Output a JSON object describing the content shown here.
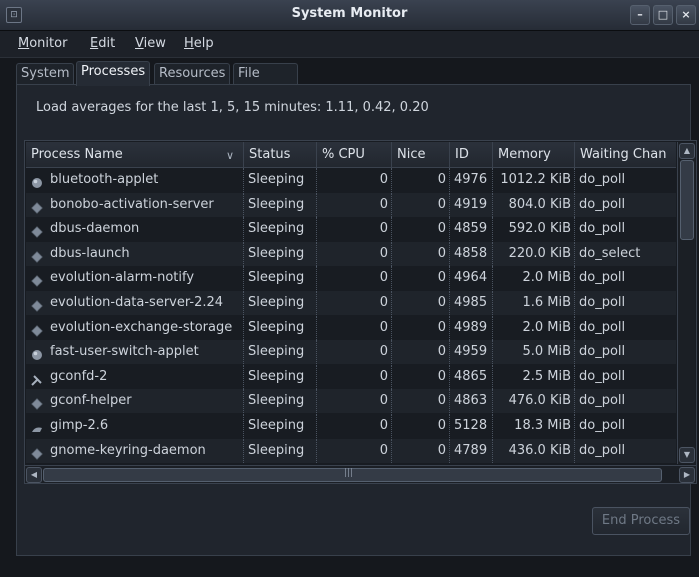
{
  "window": {
    "title": "System Monitor",
    "icon": "system-monitor-icon"
  },
  "titlebar_buttons": {
    "minimize": "–",
    "maximize": "□",
    "close": "×"
  },
  "menu": [
    "Monitor",
    "Edit",
    "View",
    "Help"
  ],
  "tabs": [
    "System",
    "Processes",
    "Resources",
    "File Systems"
  ],
  "active_tab": "Processes",
  "load_avg": "Load averages for the last 1, 5, 15 minutes: 1.11, 0.42, 0.20",
  "columns": [
    "Process Name",
    "Status",
    "% CPU",
    "Nice",
    "ID",
    "Memory",
    "Waiting Chan"
  ],
  "processes": [
    {
      "name": "bluetooth-applet",
      "status": "Sleeping",
      "cpu": "0",
      "nice": "0",
      "id": "4976",
      "memory": "1012.2 KiB",
      "wchan": "do_poll",
      "icon": "bluetooth-icon"
    },
    {
      "name": "bonobo-activation-server",
      "status": "Sleeping",
      "cpu": "0",
      "nice": "0",
      "id": "4919",
      "memory": "804.0 KiB",
      "wchan": "do_poll",
      "icon": "process-diamond-icon"
    },
    {
      "name": "dbus-daemon",
      "status": "Sleeping",
      "cpu": "0",
      "nice": "0",
      "id": "4859",
      "memory": "592.0 KiB",
      "wchan": "do_poll",
      "icon": "process-diamond-icon"
    },
    {
      "name": "dbus-launch",
      "status": "Sleeping",
      "cpu": "0",
      "nice": "0",
      "id": "4858",
      "memory": "220.0 KiB",
      "wchan": "do_select",
      "icon": "process-diamond-icon"
    },
    {
      "name": "evolution-alarm-notify",
      "status": "Sleeping",
      "cpu": "0",
      "nice": "0",
      "id": "4964",
      "memory": "2.0 MiB",
      "wchan": "do_poll",
      "icon": "process-diamond-icon"
    },
    {
      "name": "evolution-data-server-2.24",
      "status": "Sleeping",
      "cpu": "0",
      "nice": "0",
      "id": "4985",
      "memory": "1.6 MiB",
      "wchan": "do_poll",
      "icon": "process-diamond-icon"
    },
    {
      "name": "evolution-exchange-storage",
      "status": "Sleeping",
      "cpu": "0",
      "nice": "0",
      "id": "4989",
      "memory": "2.0 MiB",
      "wchan": "do_poll",
      "icon": "process-diamond-icon"
    },
    {
      "name": "fast-user-switch-applet",
      "status": "Sleeping",
      "cpu": "0",
      "nice": "0",
      "id": "4959",
      "memory": "5.0 MiB",
      "wchan": "do_poll",
      "icon": "user-icon"
    },
    {
      "name": "gconfd-2",
      "status": "Sleeping",
      "cpu": "0",
      "nice": "0",
      "id": "4865",
      "memory": "2.5 MiB",
      "wchan": "do_poll",
      "icon": "tools-icon"
    },
    {
      "name": "gconf-helper",
      "status": "Sleeping",
      "cpu": "0",
      "nice": "0",
      "id": "4863",
      "memory": "476.0 KiB",
      "wchan": "do_poll",
      "icon": "process-diamond-icon"
    },
    {
      "name": "gimp-2.6",
      "status": "Sleeping",
      "cpu": "0",
      "nice": "0",
      "id": "5128",
      "memory": "18.3 MiB",
      "wchan": "do_poll",
      "icon": "gimp-icon"
    },
    {
      "name": "gnome-keyring-daemon",
      "status": "Sleeping",
      "cpu": "0",
      "nice": "0",
      "id": "4789",
      "memory": "436.0 KiB",
      "wchan": "do_poll",
      "icon": "process-diamond-icon"
    }
  ],
  "end_process_label": "End Process",
  "scroll_arrows": {
    "up": "▲",
    "down": "▼",
    "left": "◀",
    "right": "▶"
  }
}
